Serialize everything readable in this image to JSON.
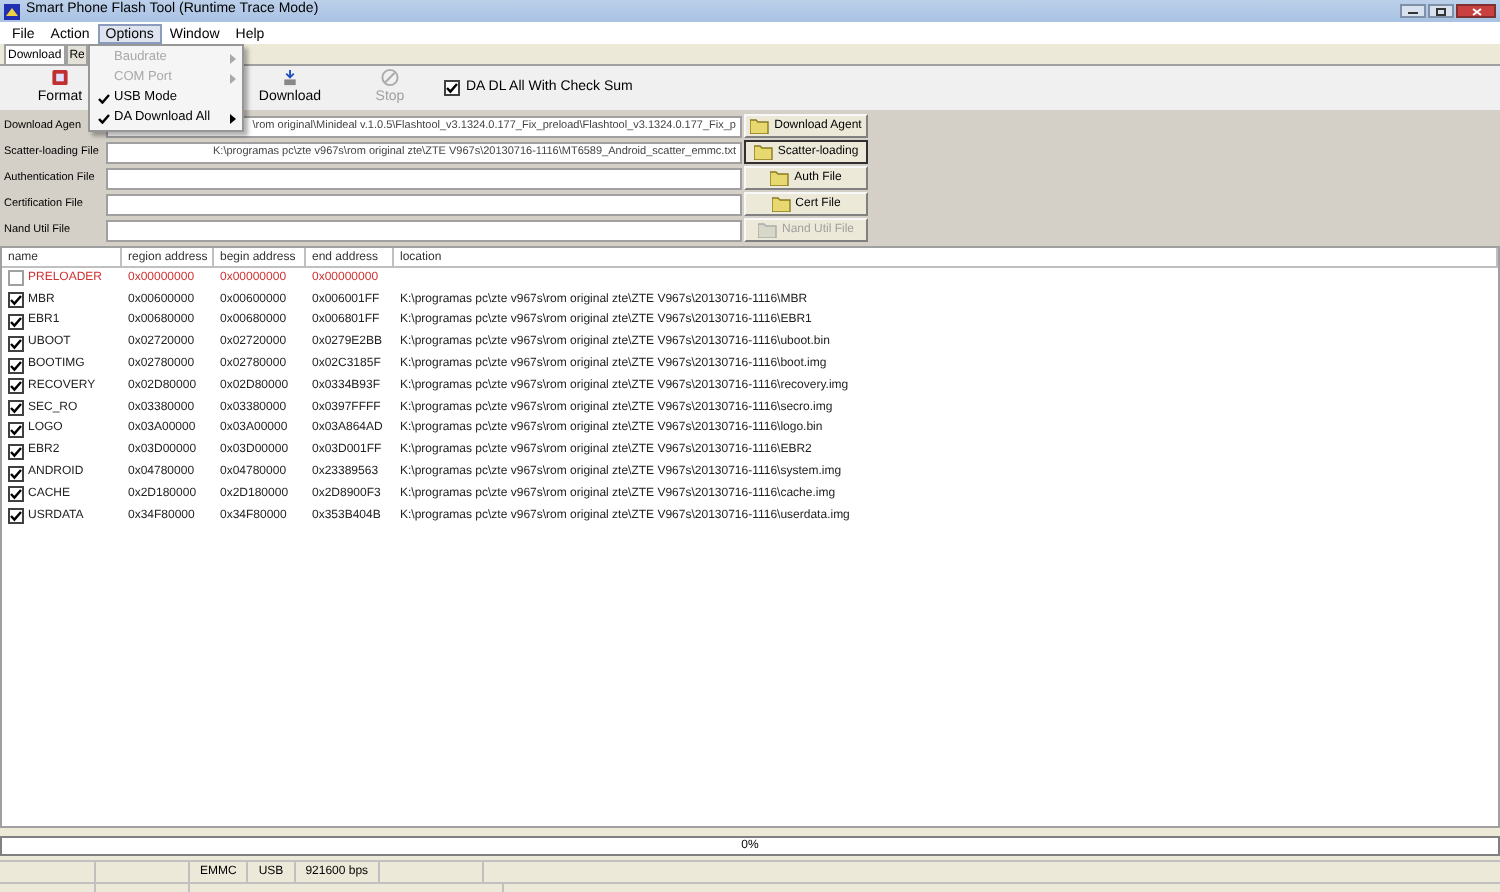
{
  "window": {
    "title": "Smart Phone Flash Tool (Runtime Trace Mode)"
  },
  "menu": [
    {
      "label": "File",
      "selected": false
    },
    {
      "label": "Action",
      "selected": false
    },
    {
      "label": "Options",
      "selected": true
    },
    {
      "label": "Window",
      "selected": false
    },
    {
      "label": "Help",
      "selected": false
    }
  ],
  "options_menu": [
    {
      "label": "Baudrate",
      "disabled": true,
      "checked": false,
      "submenu": true
    },
    {
      "label": "COM Port",
      "disabled": true,
      "checked": false,
      "submenu": true
    },
    {
      "label": "USB Mode",
      "disabled": false,
      "checked": true,
      "submenu": false
    },
    {
      "label": "DA Download All",
      "disabled": false,
      "checked": true,
      "submenu": true
    }
  ],
  "tabs": [
    {
      "label": "Download",
      "selected": true
    },
    {
      "label": "Re",
      "selected": false
    }
  ],
  "toolbar": [
    {
      "kind": "format",
      "label": "Format",
      "disabled": false
    },
    {
      "kind": "download",
      "label": "Download",
      "disabled": false
    },
    {
      "kind": "stop",
      "label": "Stop",
      "disabled": true
    }
  ],
  "checksum": {
    "label": "DA DL All With Check Sum",
    "checked": true
  },
  "files": [
    {
      "label": "Download Agen",
      "value": "\\rom original\\Minideal v.1.0.5\\Flashtool_v3.1324.0.177_Fix_preload\\Flashtool_v3.1324.0.177_Fix_p",
      "button": "Download Agent",
      "disabled": false,
      "selected": false
    },
    {
      "label": "Scatter-loading File",
      "value": "K:\\programas pc\\zte v967s\\rom original zte\\ZTE V967s\\20130716-1116\\MT6589_Android_scatter_emmc.txt",
      "button": "Scatter-loading",
      "disabled": false,
      "selected": true
    },
    {
      "label": "Authentication File",
      "button": "Auth File",
      "disabled": false,
      "selected": false
    },
    {
      "label": "Certification File",
      "button": "Cert File",
      "disabled": false,
      "selected": false
    },
    {
      "label": "Nand Util File",
      "button": "Nand Util File",
      "disabled": true,
      "selected": false
    }
  ],
  "table": {
    "columns": [
      "name",
      "region address",
      "begin address",
      "end address",
      "location"
    ],
    "rows": [
      {
        "checked": false,
        "error": true,
        "cells": [
          "PRELOADER",
          "0x00000000",
          "0x00000000",
          "0x00000000",
          ""
        ]
      },
      {
        "checked": true,
        "error": false,
        "cells": [
          "MBR",
          "0x00600000",
          "0x00600000",
          "0x006001FF",
          "K:\\programas pc\\zte v967s\\rom original zte\\ZTE V967s\\20130716-1116\\MBR"
        ]
      },
      {
        "checked": true,
        "error": false,
        "cells": [
          "EBR1",
          "0x00680000",
          "0x00680000",
          "0x006801FF",
          "K:\\programas pc\\zte v967s\\rom original zte\\ZTE V967s\\20130716-1116\\EBR1"
        ]
      },
      {
        "checked": true,
        "error": false,
        "cells": [
          "UBOOT",
          "0x02720000",
          "0x02720000",
          "0x0279E2BB",
          "K:\\programas pc\\zte v967s\\rom original zte\\ZTE V967s\\20130716-1116\\uboot.bin"
        ]
      },
      {
        "checked": true,
        "error": false,
        "cells": [
          "BOOTIMG",
          "0x02780000",
          "0x02780000",
          "0x02C3185F",
          "K:\\programas pc\\zte v967s\\rom original zte\\ZTE V967s\\20130716-1116\\boot.img"
        ]
      },
      {
        "checked": true,
        "error": false,
        "cells": [
          "RECOVERY",
          "0x02D80000",
          "0x02D80000",
          "0x0334B93F",
          "K:\\programas pc\\zte v967s\\rom original zte\\ZTE V967s\\20130716-1116\\recovery.img"
        ]
      },
      {
        "checked": true,
        "error": false,
        "cells": [
          "SEC_RO",
          "0x03380000",
          "0x03380000",
          "0x0397FFFF",
          "K:\\programas pc\\zte v967s\\rom original zte\\ZTE V967s\\20130716-1116\\secro.img"
        ]
      },
      {
        "checked": true,
        "error": false,
        "cells": [
          "LOGO",
          "0x03A00000",
          "0x03A00000",
          "0x03A864AD",
          "K:\\programas pc\\zte v967s\\rom original zte\\ZTE V967s\\20130716-1116\\logo.bin"
        ]
      },
      {
        "checked": true,
        "error": false,
        "cells": [
          "EBR2",
          "0x03D00000",
          "0x03D00000",
          "0x03D001FF",
          "K:\\programas pc\\zte v967s\\rom original zte\\ZTE V967s\\20130716-1116\\EBR2"
        ]
      },
      {
        "checked": true,
        "error": false,
        "cells": [
          "ANDROID",
          "0x04780000",
          "0x04780000",
          "0x23389563",
          "K:\\programas pc\\zte v967s\\rom original zte\\ZTE V967s\\20130716-1116\\system.img"
        ]
      },
      {
        "checked": true,
        "error": false,
        "cells": [
          "CACHE",
          "0x2D180000",
          "0x2D180000",
          "0x2D8900F3",
          "K:\\programas pc\\zte v967s\\rom original zte\\ZTE V967s\\20130716-1116\\cache.img"
        ]
      },
      {
        "checked": true,
        "error": false,
        "cells": [
          "USRDATA",
          "0x34F80000",
          "0x34F80000",
          "0x353B404B",
          "K:\\programas pc\\zte v967s\\rom original zte\\ZTE V967s\\20130716-1116\\userdata.img"
        ]
      }
    ]
  },
  "progress": {
    "level": 0,
    "reading": "0%"
  },
  "status_bar": [
    "EMMC",
    "USB",
    "921600 bps"
  ]
}
